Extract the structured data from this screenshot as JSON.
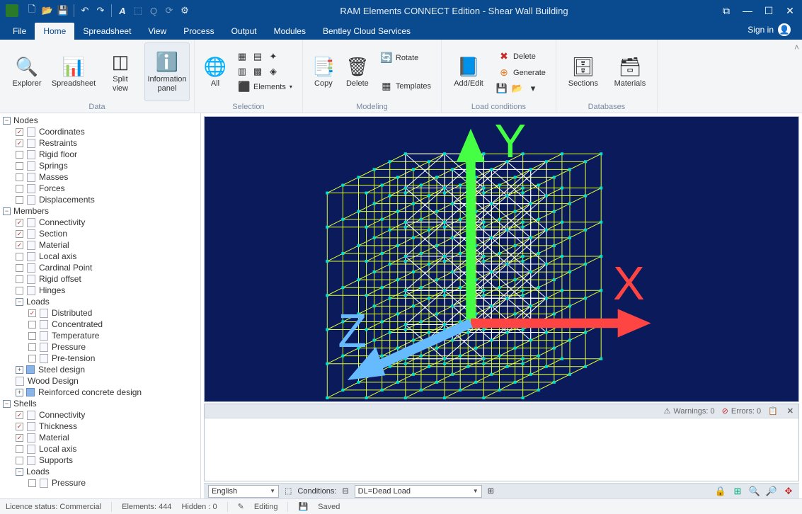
{
  "title": "RAM Elements CONNECT Edition - Shear Wall Building",
  "menu": {
    "file": "File",
    "home": "Home",
    "spreadsheet": "Spreadsheet",
    "view": "View",
    "process": "Process",
    "output": "Output",
    "modules": "Modules",
    "cloud": "Bentley Cloud Services",
    "signin": "Sign in"
  },
  "ribbon": {
    "data": {
      "label": "Data",
      "explorer": "Explorer",
      "spreadsheet": "Spreadsheet",
      "splitview": "Split\nview",
      "infopanel": "Information\npanel"
    },
    "selection": {
      "label": "Selection",
      "all": "All",
      "elements": "Elements"
    },
    "modeling": {
      "label": "Modeling",
      "copy": "Copy",
      "delete": "Delete",
      "rotate": "Rotate",
      "templates": "Templates"
    },
    "load": {
      "label": "Load conditions",
      "addedit": "Add/Edit",
      "delete": "Delete",
      "generate": "Generate"
    },
    "db": {
      "label": "Databases",
      "sections": "Sections",
      "materials": "Materials"
    }
  },
  "tree": {
    "nodes": {
      "label": "Nodes",
      "items": [
        {
          "label": "Coordinates",
          "checked": true
        },
        {
          "label": "Restraints",
          "checked": true
        },
        {
          "label": "Rigid floor",
          "checked": false
        },
        {
          "label": "Springs",
          "checked": false
        },
        {
          "label": "Masses",
          "checked": false
        },
        {
          "label": "Forces",
          "checked": false
        },
        {
          "label": "Displacements",
          "checked": false
        }
      ]
    },
    "members": {
      "label": "Members",
      "items": [
        {
          "label": "Connectivity",
          "checked": true
        },
        {
          "label": "Section",
          "checked": true
        },
        {
          "label": "Material",
          "checked": true
        },
        {
          "label": "Local axis",
          "checked": false
        },
        {
          "label": "Cardinal Point",
          "checked": false
        },
        {
          "label": "Rigid offset",
          "checked": false
        },
        {
          "label": "Hinges",
          "checked": false
        }
      ]
    },
    "loads1": {
      "label": "Loads",
      "items": [
        {
          "label": "Distributed",
          "checked": true
        },
        {
          "label": "Concentrated",
          "checked": false
        },
        {
          "label": "Temperature",
          "checked": false
        },
        {
          "label": "Pressure",
          "checked": false
        },
        {
          "label": "Pre-tension",
          "checked": false
        }
      ]
    },
    "steel": "Steel design",
    "wood": "Wood Design",
    "rc": "Reinforced concrete design",
    "shells": {
      "label": "Shells",
      "items": [
        {
          "label": "Connectivity",
          "checked": true
        },
        {
          "label": "Thickness",
          "checked": true
        },
        {
          "label": "Material",
          "checked": true
        },
        {
          "label": "Local axis",
          "checked": false
        },
        {
          "label": "Supports",
          "checked": false
        }
      ]
    },
    "loads2": {
      "label": "Loads",
      "items": [
        {
          "label": "Pressure",
          "checked": false
        }
      ]
    }
  },
  "msg": {
    "warnings": "Warnings: 0",
    "errors": "Errors: 0"
  },
  "cond": {
    "label": "Conditions:",
    "english": "English",
    "value": "DL=Dead Load"
  },
  "status": {
    "licence": "Licence status: Commercial",
    "elements": "Elements: 444",
    "hidden": "Hidden : 0",
    "editing": "Editing",
    "saved": "Saved"
  },
  "axes": {
    "x": "X",
    "y": "Y",
    "z": "Z"
  }
}
